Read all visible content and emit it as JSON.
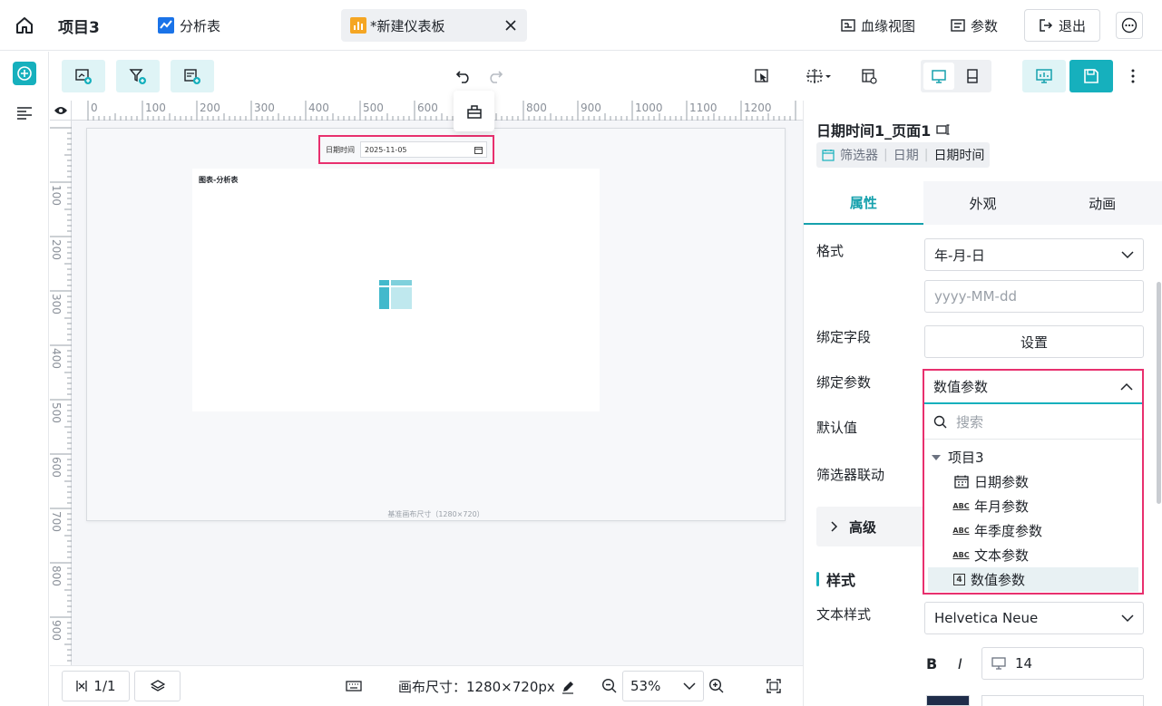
{
  "header": {
    "project_name": "项目3",
    "analysis_tab": "分析表",
    "dashboard_tab": "*新建仪表板",
    "lineage_view": "血缘视图",
    "params": "参数",
    "exit": "退出"
  },
  "ruler": {
    "top_marks": [
      "0",
      "100",
      "200",
      "300",
      "400",
      "500",
      "600",
      "700",
      "800",
      "900",
      "1000",
      "1100",
      "1200"
    ],
    "left_marks": [
      "100",
      "200",
      "300",
      "400",
      "500",
      "600",
      "700",
      "800",
      "900"
    ]
  },
  "canvas": {
    "filter_label": "日期时间",
    "filter_value": "2025-11-05",
    "chart_title": "图表-分析表",
    "footer": "基准画布尺寸（1280×720）"
  },
  "bottombar": {
    "page_indicator": "1/1",
    "canvas_size": "画布尺寸：1280×720px",
    "zoom": "53%"
  },
  "panel": {
    "title": "日期时间1_页面1",
    "crumb": [
      "筛选器",
      "日期",
      "日期时间"
    ],
    "tabs": [
      "属性",
      "外观",
      "动画"
    ],
    "format_label": "格式",
    "format_value": "年-月-日",
    "format_pattern": "yyyy-MM-dd",
    "bind_field_label": "绑定字段",
    "bind_field_btn": "设置",
    "bind_param_label": "绑定参数",
    "default_label": "默认值",
    "linkage_label": "筛选器联动",
    "advanced": "高级",
    "style_section": "样式",
    "text_style_label": "文本样式",
    "font_value": "Helvetica Neue",
    "bold": "B",
    "italic": "I",
    "font_size": "14"
  },
  "bind_dropdown": {
    "selected": "数值参数",
    "search_placeholder": "搜索",
    "group": "项目3",
    "items": [
      {
        "label": "日期参数",
        "icon": "calendar-icon"
      },
      {
        "label": "年月参数",
        "icon": "abc-icon"
      },
      {
        "label": "年季度参数",
        "icon": "abc-icon"
      },
      {
        "label": "文本参数",
        "icon": "abc-icon"
      },
      {
        "label": "数值参数",
        "icon": "number-icon"
      }
    ],
    "icon_texts": [
      "ABC",
      "4"
    ]
  },
  "colors": {
    "accent": "#16b0bd",
    "highlight": "#e8306e"
  }
}
